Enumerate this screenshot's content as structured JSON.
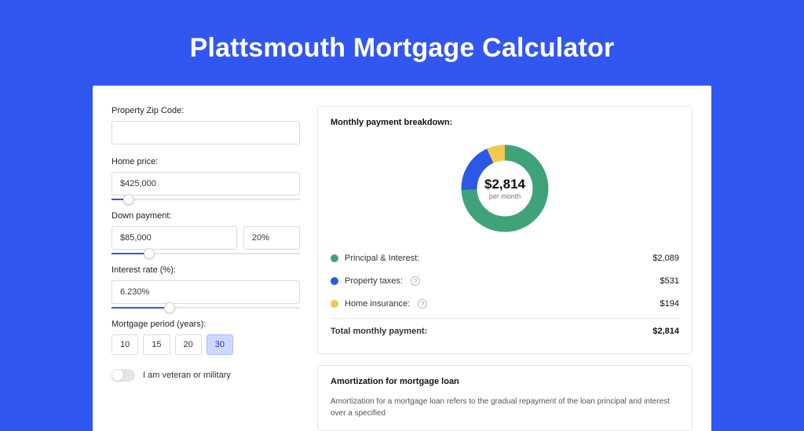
{
  "title": "Plattsmouth Mortgage Calculator",
  "form": {
    "zip_label": "Property Zip Code:",
    "zip_value": "",
    "home_label": "Home price:",
    "home_value": "$425,000",
    "home_slider_pct": 9,
    "down_label": "Down payment:",
    "down_value": "$85,000",
    "down_pct": "20%",
    "down_slider_pct": 20,
    "rate_label": "Interest rate (%):",
    "rate_value": "6.230%",
    "rate_slider_pct": 31,
    "period_label": "Mortgage period (years):",
    "veteran_label": "I am veteran or military"
  },
  "periods": [
    {
      "label": "10",
      "active": false
    },
    {
      "label": "15",
      "active": false
    },
    {
      "label": "20",
      "active": false
    },
    {
      "label": "30",
      "active": true
    }
  ],
  "breakdown": {
    "title": "Monthly payment breakdown:",
    "center_value": "$2,814",
    "center_sub": "per month",
    "rows": [
      {
        "label": "Principal & Interest:",
        "value": "$2,089",
        "color": "#3fa37a",
        "help": false
      },
      {
        "label": "Property taxes:",
        "value": "$531",
        "color": "#2b59e3",
        "help": true
      },
      {
        "label": "Home insurance:",
        "value": "$194",
        "color": "#f2c94c",
        "help": true
      }
    ],
    "total_label": "Total monthly payment:",
    "total_value": "$2,814"
  },
  "amort": {
    "title": "Amortization for mortgage loan",
    "text": "Amortization for a mortgage loan refers to the gradual repayment of the loan principal and interest over a specified"
  },
  "colors": {
    "principal": "#3fa37a",
    "taxes": "#2b59e3",
    "insurance": "#f2c94c"
  },
  "chart_data": {
    "type": "pie",
    "title": "Monthly payment breakdown",
    "series": [
      {
        "name": "Principal & Interest",
        "value": 2089,
        "color": "#3fa37a"
      },
      {
        "name": "Property taxes",
        "value": 531,
        "color": "#2b59e3"
      },
      {
        "name": "Home insurance",
        "value": 194,
        "color": "#f2c94c"
      }
    ],
    "total": 2814,
    "center_label": "$2,814 per month"
  }
}
